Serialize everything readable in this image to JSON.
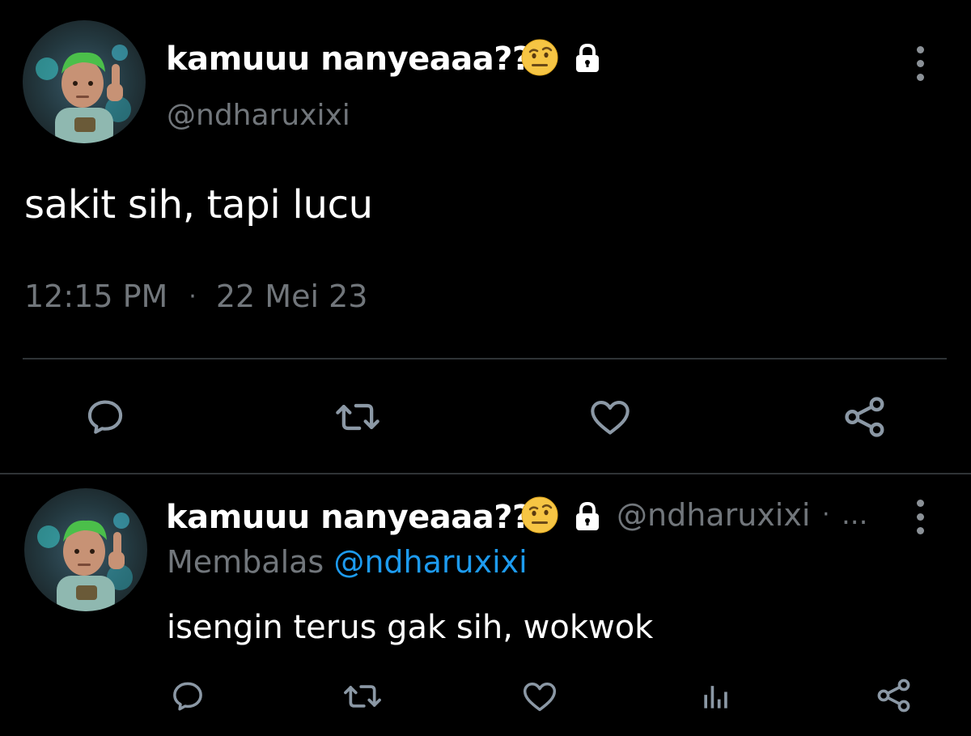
{
  "main_tweet": {
    "display_name": "kamuuu nanyeaaa???",
    "handle": "@ndharuxixi",
    "text": "sakit sih, tapi lucu",
    "time": "12:15 PM",
    "separator": "·",
    "date": "22 Mei 23",
    "emoji": "face-with-raised-eyebrow",
    "badge_icon": "lock-icon",
    "actions": [
      "reply-icon",
      "retweet-icon",
      "like-icon",
      "share-icon"
    ]
  },
  "reply_tweet": {
    "display_name": "kamuuu nanyeaaa???",
    "handle": "@ndharuxixi",
    "separator": "·",
    "more": "...",
    "replying_prefix": "Membalas",
    "replying_to": "@ndharuxixi",
    "text": "isengin terus gak sih, wokwok",
    "actions": [
      "reply-icon",
      "retweet-icon",
      "like-icon",
      "analytics-icon",
      "share-icon"
    ]
  },
  "colors": {
    "background": "#000000",
    "text_primary": "#ffffff",
    "text_secondary": "#71767b",
    "link": "#1d9bf0",
    "divider": "#2f3336",
    "icon": "#8b98a5"
  }
}
